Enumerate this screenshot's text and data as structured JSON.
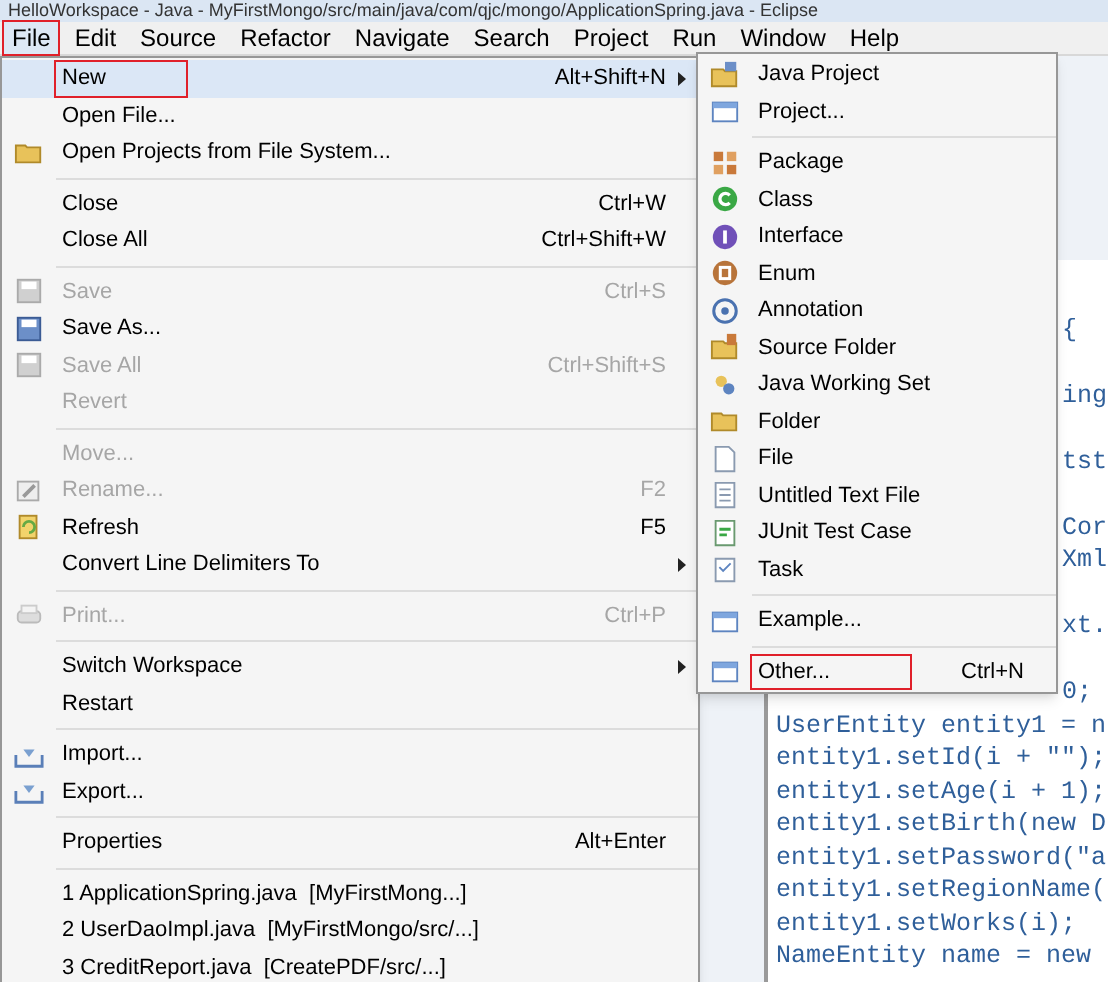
{
  "window": {
    "title": "HelloWorkspace - Java - MyFirstMongo/src/main/java/com/qjc/mongo/ApplicationSpring.java - Eclipse"
  },
  "menubar": [
    {
      "label": "File",
      "selected": true,
      "highlighted": true
    },
    {
      "label": "Edit",
      "selected": false,
      "highlighted": false
    },
    {
      "label": "Source",
      "selected": false,
      "highlighted": false
    },
    {
      "label": "Refactor",
      "selected": false,
      "highlighted": false
    },
    {
      "label": "Navigate",
      "selected": false,
      "highlighted": false
    },
    {
      "label": "Search",
      "selected": false,
      "highlighted": false
    },
    {
      "label": "Project",
      "selected": false,
      "highlighted": false
    },
    {
      "label": "Run",
      "selected": false,
      "highlighted": false
    },
    {
      "label": "Window",
      "selected": false,
      "highlighted": false
    },
    {
      "label": "Help",
      "selected": false,
      "highlighted": false
    }
  ],
  "file_menu": [
    {
      "kind": "item",
      "label": "New",
      "shortcut": "Alt+Shift+N",
      "submenu": true,
      "disabled": false,
      "selected": true,
      "highlighted": true
    },
    {
      "kind": "item",
      "label": "Open File...",
      "disabled": false,
      "selected": false,
      "highlighted": false
    },
    {
      "kind": "item",
      "label": "Open Projects from File System...",
      "disabled": false,
      "selected": false,
      "highlighted": false
    },
    {
      "kind": "separator"
    },
    {
      "kind": "item",
      "label": "Close",
      "shortcut": "Ctrl+W",
      "disabled": false,
      "selected": false,
      "highlighted": false
    },
    {
      "kind": "item",
      "label": "Close All",
      "shortcut": "Ctrl+Shift+W",
      "disabled": false,
      "selected": false,
      "highlighted": false
    },
    {
      "kind": "separator"
    },
    {
      "kind": "item",
      "label": "Save",
      "shortcut": "Ctrl+S",
      "disabled": true,
      "selected": false,
      "highlighted": false
    },
    {
      "kind": "item",
      "label": "Save As...",
      "disabled": false,
      "selected": false,
      "highlighted": false
    },
    {
      "kind": "item",
      "label": "Save All",
      "shortcut": "Ctrl+Shift+S",
      "disabled": true,
      "selected": false,
      "highlighted": false
    },
    {
      "kind": "item",
      "label": "Revert",
      "disabled": true,
      "selected": false,
      "highlighted": false
    },
    {
      "kind": "separator"
    },
    {
      "kind": "item",
      "label": "Move...",
      "disabled": true,
      "selected": false,
      "highlighted": false
    },
    {
      "kind": "item",
      "label": "Rename...",
      "shortcut": "F2",
      "disabled": true,
      "selected": false,
      "highlighted": false
    },
    {
      "kind": "item",
      "label": "Refresh",
      "shortcut": "F5",
      "disabled": false,
      "selected": false,
      "highlighted": false
    },
    {
      "kind": "item",
      "label": "Convert Line Delimiters To",
      "submenu": true,
      "disabled": false,
      "selected": false,
      "highlighted": false
    },
    {
      "kind": "separator"
    },
    {
      "kind": "item",
      "label": "Print...",
      "shortcut": "Ctrl+P",
      "disabled": true,
      "selected": false,
      "highlighted": false
    },
    {
      "kind": "separator"
    },
    {
      "kind": "item",
      "label": "Switch Workspace",
      "submenu": true,
      "disabled": false,
      "selected": false,
      "highlighted": false
    },
    {
      "kind": "item",
      "label": "Restart",
      "disabled": false,
      "selected": false,
      "highlighted": false
    },
    {
      "kind": "separator"
    },
    {
      "kind": "item",
      "label": "Import...",
      "disabled": false,
      "selected": false,
      "highlighted": false
    },
    {
      "kind": "item",
      "label": "Export...",
      "disabled": false,
      "selected": false,
      "highlighted": false
    },
    {
      "kind": "separator"
    },
    {
      "kind": "item",
      "label": "Properties",
      "shortcut": "Alt+Enter",
      "disabled": false,
      "selected": false,
      "highlighted": false
    },
    {
      "kind": "separator"
    },
    {
      "kind": "item",
      "label": "1 ApplicationSpring.java  [MyFirstMong...]",
      "disabled": false,
      "selected": false,
      "highlighted": false
    },
    {
      "kind": "item",
      "label": "2 UserDaoImpl.java  [MyFirstMongo/src/...]",
      "disabled": false,
      "selected": false,
      "highlighted": false
    },
    {
      "kind": "item",
      "label": "3 CreditReport.java  [CreatePDF/src/...]",
      "disabled": false,
      "selected": false,
      "highlighted": false
    }
  ],
  "new_submenu": [
    {
      "kind": "item",
      "label": "Java Project",
      "selected": false,
      "highlighted": false
    },
    {
      "kind": "item",
      "label": "Project...",
      "selected": false,
      "highlighted": false
    },
    {
      "kind": "separator"
    },
    {
      "kind": "item",
      "label": "Package",
      "selected": false,
      "highlighted": false
    },
    {
      "kind": "item",
      "label": "Class",
      "selected": false,
      "highlighted": false
    },
    {
      "kind": "item",
      "label": "Interface",
      "selected": false,
      "highlighted": false
    },
    {
      "kind": "item",
      "label": "Enum",
      "selected": false,
      "highlighted": false
    },
    {
      "kind": "item",
      "label": "Annotation",
      "selected": false,
      "highlighted": false
    },
    {
      "kind": "item",
      "label": "Source Folder",
      "selected": false,
      "highlighted": false
    },
    {
      "kind": "item",
      "label": "Java Working Set",
      "selected": false,
      "highlighted": false
    },
    {
      "kind": "item",
      "label": "Folder",
      "selected": false,
      "highlighted": false
    },
    {
      "kind": "item",
      "label": "File",
      "selected": false,
      "highlighted": false
    },
    {
      "kind": "item",
      "label": "Untitled Text File",
      "selected": false,
      "highlighted": false
    },
    {
      "kind": "item",
      "label": "JUnit Test Case",
      "selected": false,
      "highlighted": false
    },
    {
      "kind": "item",
      "label": "Task",
      "selected": false,
      "highlighted": false
    },
    {
      "kind": "separator"
    },
    {
      "kind": "item",
      "label": "Example...",
      "selected": false,
      "highlighted": false
    },
    {
      "kind": "separator"
    },
    {
      "kind": "item",
      "label": "Other...",
      "shortcut": "Ctrl+N",
      "selected": false,
      "highlighted": true
    }
  ],
  "editor": {
    "lines": [
      {
        "kind": "fragment",
        "text": "{"
      },
      {
        "kind": "blank"
      },
      {
        "kind": "fragment",
        "text": "ing"
      },
      {
        "kind": "blank"
      },
      {
        "kind": "fragment",
        "text": "tst"
      },
      {
        "kind": "blank"
      },
      {
        "kind": "fragment",
        "text": "Cor"
      },
      {
        "kind": "fragment",
        "text": "Xml"
      },
      {
        "kind": "blank"
      },
      {
        "kind": "fragment",
        "text": "xt."
      },
      {
        "kind": "blank"
      },
      {
        "kind": "fragment",
        "text": "0;"
      },
      {
        "kind": "line",
        "text": "UserEntity entity1 = n"
      },
      {
        "kind": "line",
        "text": "entity1.setId(i + \"\");"
      },
      {
        "kind": "line",
        "text": "entity1.setAge(i + 1);"
      },
      {
        "kind": "line",
        "text": "entity1.setBirth(new D"
      },
      {
        "kind": "line",
        "text": "entity1.setPassword(\"a"
      },
      {
        "kind": "line",
        "text": "entity1.setRegionName("
      },
      {
        "kind": "line",
        "text": "entity1.setWorks(i);"
      },
      {
        "kind": "line",
        "text": "NameEntity name = new"
      }
    ]
  }
}
